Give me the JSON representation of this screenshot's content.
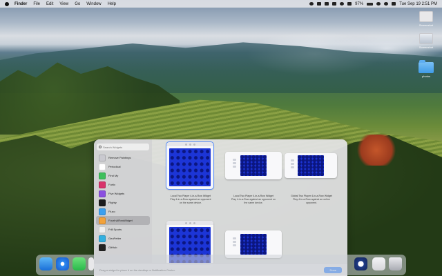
{
  "menubar": {
    "app_name": "Finder",
    "menus": [
      "File",
      "Edit",
      "View",
      "Go",
      "Window",
      "Help"
    ],
    "battery": "97%",
    "datetime": "Tue Sep 19  2:51 PM"
  },
  "desktop": {
    "icons": [
      {
        "label": "Screenshot"
      },
      {
        "label": "Screenshot"
      },
      {
        "label": "photos"
      }
    ]
  },
  "gallery": {
    "search_placeholder": "Search Widgets",
    "apps": [
      {
        "label": "Remove Paintings",
        "color": "#c9c9cf"
      },
      {
        "label": "Periodical",
        "color": "#ffffff"
      },
      {
        "label": "Find My",
        "color": "#3fbf5c"
      },
      {
        "label": "Fortix",
        "color": "#d8336b"
      },
      {
        "label": "Five Widgets",
        "color": "#8a4fe0"
      },
      {
        "label": "Flighty",
        "color": "#1d1d1f"
      },
      {
        "label": "Fluxo",
        "color": "#3aa0f0"
      },
      {
        "label": "FourInARowWidget",
        "color": "#f2a23a",
        "selected": true
      },
      {
        "label": "Frill Sports",
        "color": "#efefef"
      },
      {
        "label": "GeoPetter",
        "color": "#33b0e0"
      },
      {
        "label": "GitHub",
        "color": "#222"
      }
    ],
    "widgets": [
      {
        "title": "Local Two Player 4-in-a-Row Widget",
        "desc": "Play 4-in-a-Row against an opponent on the same device."
      },
      {
        "title": "Local Two Player 4-in-a-Row Widget",
        "desc": "Play 4-in-a-Row against an opponent on the same device."
      },
      {
        "title": "Global Two Player 4-in-a-Row Widget",
        "desc": "Play 4-in-a-Row against an online opponent."
      }
    ],
    "hint": "Drag a widget to place it on the desktop or Notification Center.",
    "done_label": "Done"
  }
}
